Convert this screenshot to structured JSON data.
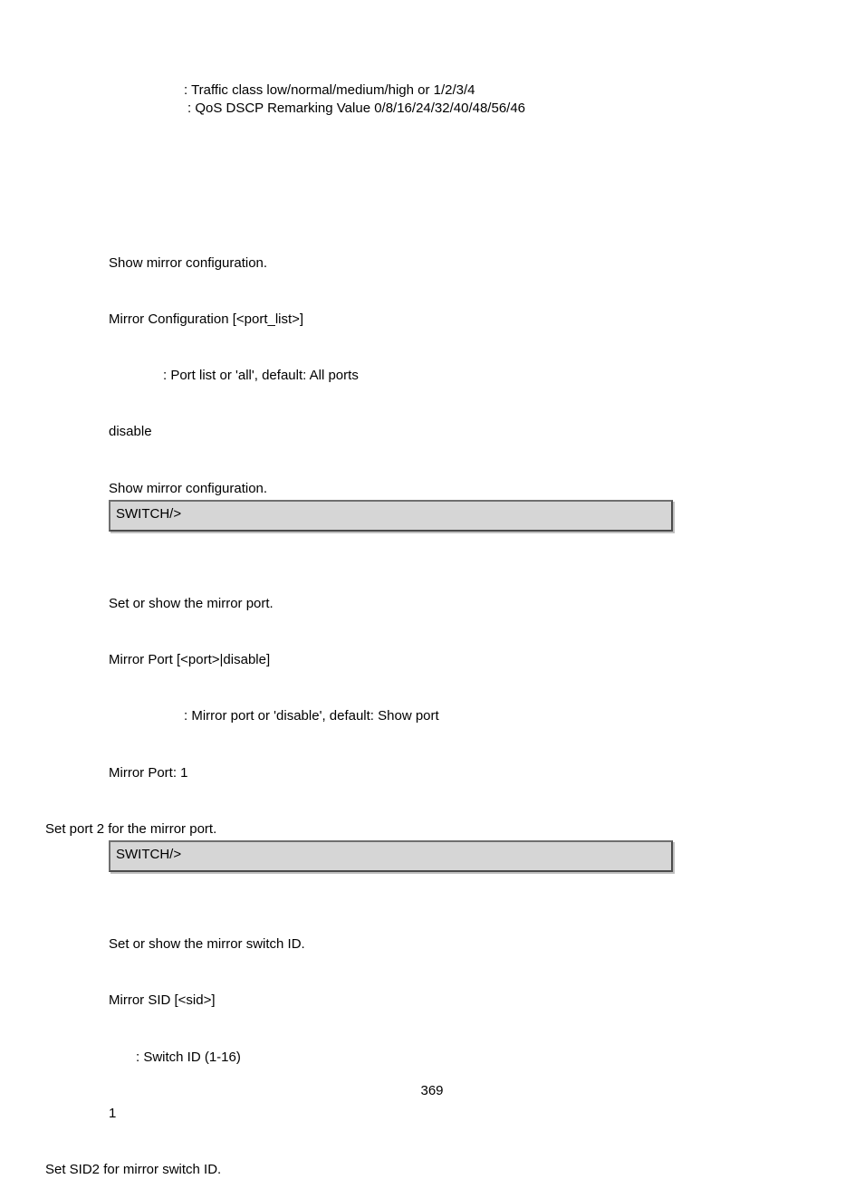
{
  "top": {
    "line1": ": Traffic class low/normal/medium/high or 1/2/3/4",
    "line2": " : QoS DSCP Remarking Value 0/8/16/24/32/40/48/56/46"
  },
  "sec1": {
    "desc": "Show mirror configuration.",
    "syntax": "Mirror Configuration [<port_list>]",
    "param": ": Port list or 'all', default: All ports",
    "default": " disable",
    "example_intro": "Show mirror configuration.",
    "prompt": "SWITCH/>"
  },
  "sec2": {
    "desc": "Set or show the mirror port.",
    "syntax": "Mirror Port [<port>|disable]",
    "param": ": Mirror port or 'disable', default: Show port",
    "default": " Mirror Port: 1",
    "example_intro": "Set port 2 for the mirror port.",
    "prompt": "SWITCH/>"
  },
  "sec3": {
    "desc": "Set or show the mirror switch ID.",
    "syntax": "Mirror SID [<sid>]",
    "param": ": Switch ID (1-16)",
    "default": " 1",
    "example_intro": "Set SID2 for mirror switch ID."
  },
  "page_number": "369"
}
